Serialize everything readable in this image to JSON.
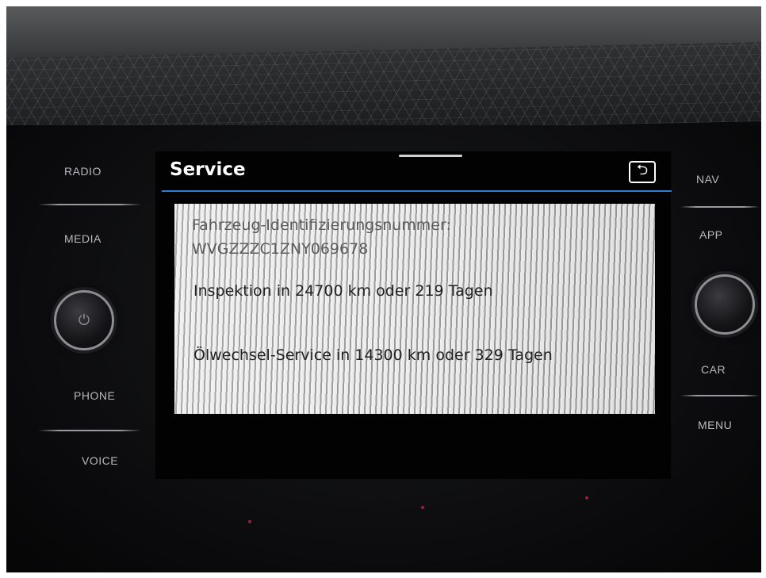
{
  "left_buttons": [
    "RADIO",
    "MEDIA",
    "PHONE",
    "VOICE"
  ],
  "right_buttons": [
    "NAV",
    "APP",
    "CAR",
    "MENU"
  ],
  "screen": {
    "title": "Service",
    "back_icon": "return-arrow-icon",
    "vin_label": "Fahrzeug-Identifizierungsnummer:",
    "vin_value": "WVGZZZC1ZNY069678",
    "inspection": "Inspektion in 24700 km oder 219 Tagen",
    "oil_service": "Ölwechsel-Service in 14300 km oder 329 Tagen"
  },
  "colors": {
    "title_rule": "#2d7cd1",
    "screen_bg": "#020203",
    "panel_bg": "#e8e8e8"
  }
}
